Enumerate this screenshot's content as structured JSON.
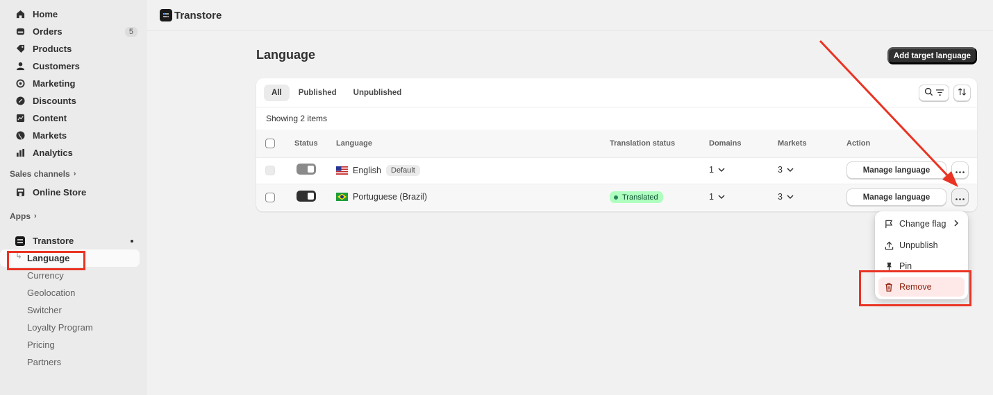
{
  "sidebar": {
    "items": [
      {
        "label": "Home",
        "icon": "home-icon"
      },
      {
        "label": "Orders",
        "icon": "orders-icon",
        "badge": "5"
      },
      {
        "label": "Products",
        "icon": "tag-icon"
      },
      {
        "label": "Customers",
        "icon": "person-icon"
      },
      {
        "label": "Marketing",
        "icon": "target-icon"
      },
      {
        "label": "Discounts",
        "icon": "discount-icon"
      },
      {
        "label": "Content",
        "icon": "content-icon"
      },
      {
        "label": "Markets",
        "icon": "globe-icon"
      },
      {
        "label": "Analytics",
        "icon": "bar-chart-icon"
      }
    ],
    "sales_channels_label": "Sales channels",
    "online_store_label": "Online Store",
    "apps_label": "Apps",
    "app_name": "Transtore",
    "app_subitems": [
      "Language",
      "Currency",
      "Geolocation",
      "Switcher",
      "Loyalty Program",
      "Pricing",
      "Partners"
    ]
  },
  "topbar": {
    "title": "Transtore"
  },
  "page": {
    "title": "Language",
    "add_button": "Add target language"
  },
  "tabs": [
    "All",
    "Published",
    "Unpublished"
  ],
  "showing": "Showing 2 items",
  "table": {
    "headers": [
      "Status",
      "Language",
      "Translation status",
      "Domains",
      "Markets",
      "Action"
    ],
    "rows": [
      {
        "language": "English",
        "flag": "us-flag",
        "default_badge": "Default",
        "translation_status": "",
        "domains": "1",
        "markets": "3",
        "action": "Manage language",
        "published": false
      },
      {
        "language": "Portuguese (Brazil)",
        "flag": "brazil-flag",
        "default_badge": "",
        "translation_status": "Translated",
        "domains": "1",
        "markets": "3",
        "action": "Manage language",
        "published": true
      }
    ]
  },
  "menu": {
    "items": [
      "Change flag",
      "Unpublish",
      "Pin",
      "Remove"
    ]
  },
  "colors": {
    "accent": "#303030",
    "annotation": "#ea3323",
    "success_badge": "#affebf",
    "danger_bg": "#fee9e8"
  }
}
